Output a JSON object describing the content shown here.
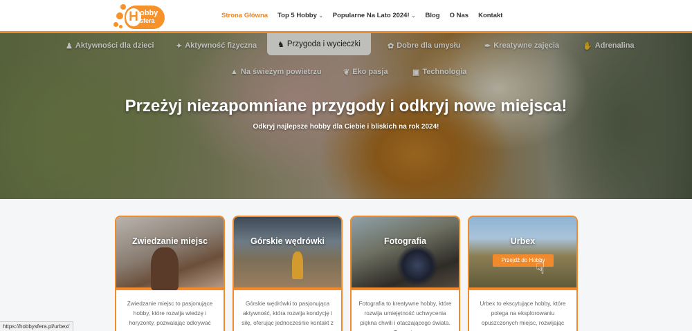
{
  "brand": {
    "line1": "obby",
    "line2": "sfera",
    "mark": "H"
  },
  "nav": [
    {
      "label": "Strona Główna",
      "active": true,
      "dropdown": false
    },
    {
      "label": "Top 5 Hobby",
      "active": false,
      "dropdown": true
    },
    {
      "label": "Popularne Na Lato 2024!",
      "active": false,
      "dropdown": true
    },
    {
      "label": "Blog",
      "active": false,
      "dropdown": false
    },
    {
      "label": "O Nas",
      "active": false,
      "dropdown": false
    },
    {
      "label": "Kontakt",
      "active": false,
      "dropdown": false
    }
  ],
  "categories": [
    {
      "label": "Aktywności dla dzieci",
      "icon": "child-icon"
    },
    {
      "label": "Aktywność fizyczna",
      "icon": "running-icon"
    },
    {
      "label": "Przygoda i wycieczki",
      "icon": "hiking-icon"
    },
    {
      "label": "Dobre dla umysłu",
      "icon": "brain-icon"
    },
    {
      "label": "Kreatywne zajęcia",
      "icon": "brush-icon"
    },
    {
      "label": "Adrenalina",
      "icon": "hand-icon"
    },
    {
      "label": "Na świeżym powietrzu",
      "icon": "tree-icon"
    },
    {
      "label": "Eko pasja",
      "icon": "leaf-icon"
    },
    {
      "label": "Technologia",
      "icon": "laptop-icon"
    }
  ],
  "hero": {
    "title": "Przeżyj niezapomniane przygody i odkryj nowe miejsca!",
    "subtitle": "Odkryj najlepsze hobby dla Ciebie i bliskich na rok 2024!"
  },
  "cards": [
    {
      "title": "Zwiedzanie miejsc",
      "desc": "Zwiedzanie miejsc to pasjonujące hobby, które rozwija wiedzę i horyzonty, pozwalając odkrywać nowe"
    },
    {
      "title": "Górskie wędrówki",
      "desc": "Górskie wędrówki to pasjonująca aktywność, która rozwija kondycję i siłę, oferując jednocześnie kontakt z"
    },
    {
      "title": "Fotografia",
      "desc": "Fotografia to kreatywne hobby, które rozwija umiejętność uchwycenia piękna chwili i otaczającego świata. To pasja,"
    },
    {
      "title": "Urbex",
      "desc": "Urbex to ekscytujące hobby, które polega na eksplorowaniu opuszczonych miejsc, rozwijając",
      "cta": "Przejdź do Hobby"
    }
  ],
  "status_url": "https://hobbysfera.pl/urbex/",
  "colors": {
    "accent": "#f08a2c",
    "nav_active": "#e9862a"
  }
}
